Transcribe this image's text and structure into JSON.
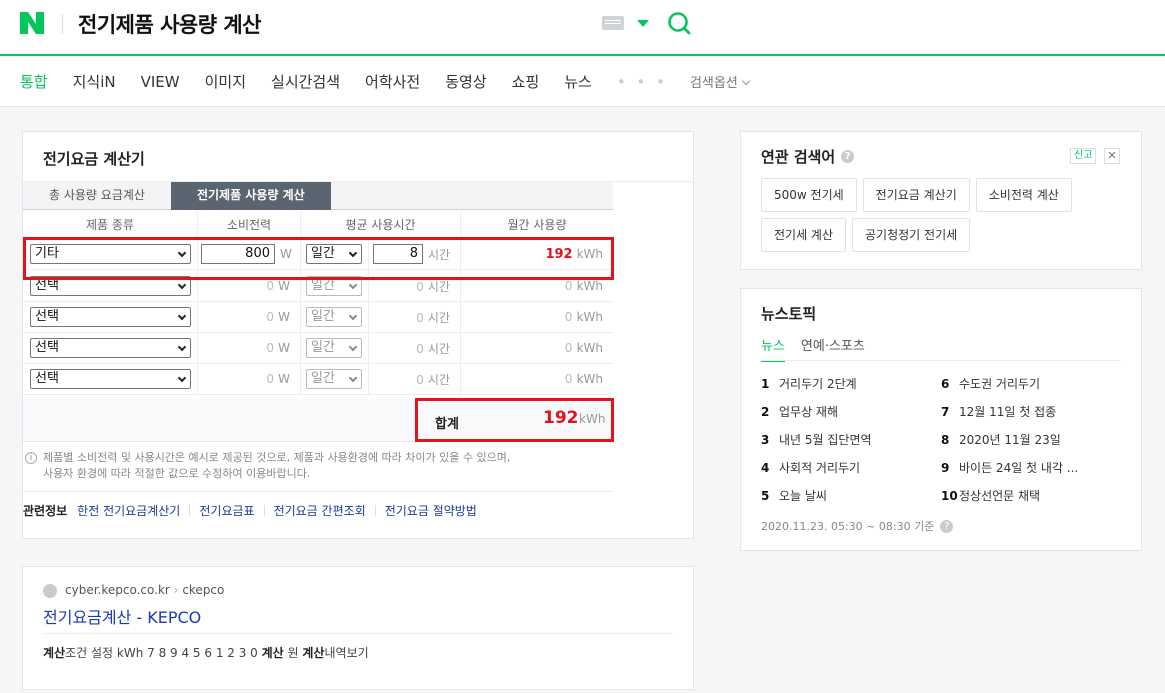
{
  "header": {
    "query": "전기제품 사용량 계산",
    "colors": {
      "brand": "#03c75a",
      "alert": "#e0151a"
    }
  },
  "tabs": {
    "items": [
      "통합",
      "지식iN",
      "VIEW",
      "이미지",
      "실시간검색",
      "어학사전",
      "동영상",
      "쇼핑",
      "뉴스"
    ],
    "more": "• • •",
    "options_label": "검색옵션"
  },
  "calc": {
    "title": "전기요금 계산기",
    "tab_total": "총 사용량 요금계산",
    "tab_appliance": "전기제품 사용량 계산",
    "headers": [
      "제품 종류",
      "소비전력",
      "평균 사용시간",
      "월간 사용량"
    ],
    "rows": [
      {
        "product": "기타",
        "watt": "800",
        "watt_unit": "W",
        "period": "일간",
        "hours": "8",
        "hours_unit": "시간",
        "kwh": "192",
        "kwh_unit": "kWh"
      },
      {
        "product": "선택",
        "watt": "0",
        "watt_unit": "W",
        "period": "일간",
        "hours": "0",
        "hours_unit": "시간",
        "kwh": "0",
        "kwh_unit": "kWh"
      },
      {
        "product": "선택",
        "watt": "0",
        "watt_unit": "W",
        "period": "일간",
        "hours": "0",
        "hours_unit": "시간",
        "kwh": "0",
        "kwh_unit": "kWh"
      },
      {
        "product": "선택",
        "watt": "0",
        "watt_unit": "W",
        "period": "일간",
        "hours": "0",
        "hours_unit": "시간",
        "kwh": "0",
        "kwh_unit": "kWh"
      },
      {
        "product": "선택",
        "watt": "0",
        "watt_unit": "W",
        "period": "일간",
        "hours": "0",
        "hours_unit": "시간",
        "kwh": "0",
        "kwh_unit": "kWh"
      }
    ],
    "total_label": "합계",
    "total_value": "192",
    "total_unit": "kWh",
    "notice_line1": "제품별 소비전력 및 사용시간은 예시로 제공된 것으로, 제품과 사용환경에 따라 차이가 있을 수 있으며,",
    "notice_line2": "사용자 환경에 따라 적절한 값으로 수정하여 이용바랍니다.",
    "related_title": "관련정보",
    "related_links": [
      "한전 전기요금계산기",
      "전기요금표",
      "전기요금 간편조회",
      "전기요금 절약방법"
    ]
  },
  "kepco": {
    "site": "cyber.kepco.co.kr",
    "path": "ckepco",
    "title": "전기요금계산 - KEPCO",
    "desc_b1": "계산",
    "desc_t1": "조건 설정 kWh 7 8 9 4 5 6 1 2 3 0 ",
    "desc_b2": "계산",
    "desc_t2": " 원 ",
    "desc_b3": "계산",
    "desc_t3": "내역보기"
  },
  "related_search": {
    "title": "연관 검색어",
    "report": "신고",
    "close": "✕",
    "chips": [
      "500w 전기세",
      "전기요금 계산기",
      "소비전력 계산",
      "전기세 계산",
      "공기청정기 전기세"
    ]
  },
  "news_topic": {
    "title": "뉴스토픽",
    "tabs": [
      "뉴스",
      "연예·스포츠"
    ],
    "items": [
      {
        "rank": "1",
        "text": "거리두기 2단계"
      },
      {
        "rank": "2",
        "text": "업무상 재해"
      },
      {
        "rank": "3",
        "text": "내년 5월 집단면역"
      },
      {
        "rank": "4",
        "text": "사회적 거리두기"
      },
      {
        "rank": "5",
        "text": "오늘 날씨"
      },
      {
        "rank": "6",
        "text": "수도권 거리두기"
      },
      {
        "rank": "7",
        "text": "12월 11일 첫 접종"
      },
      {
        "rank": "8",
        "text": "2020년 11월 23일"
      },
      {
        "rank": "9",
        "text": "바이든 24일 첫 내각 ..."
      },
      {
        "rank": "10",
        "text": "정상선언문 채택"
      }
    ],
    "footer": "2020.11.23. 05:30 ~ 08:30 기준"
  }
}
